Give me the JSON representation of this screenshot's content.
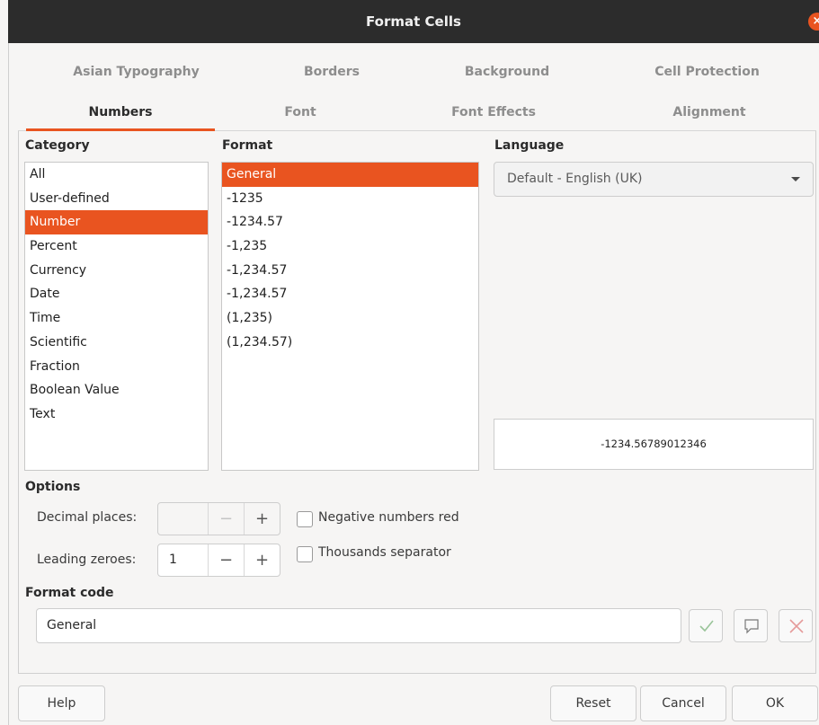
{
  "window": {
    "title": "Format Cells"
  },
  "tabs": {
    "row1": [
      "Asian Typography",
      "Borders",
      "Background",
      "Cell Protection"
    ],
    "row2": [
      "Numbers",
      "Font",
      "Font Effects",
      "Alignment"
    ],
    "active": "Numbers"
  },
  "category": {
    "label": "Category",
    "items": [
      "All",
      "User-defined",
      "Number",
      "Percent",
      "Currency",
      "Date",
      "Time",
      "Scientific",
      "Fraction",
      "Boolean Value",
      "Text"
    ],
    "selected": "Number"
  },
  "format": {
    "label": "Format",
    "items": [
      "General",
      "-1235",
      "-1234.57",
      "-1,235",
      "-1,234.57",
      "-1,234.57",
      "(1,235)",
      "(1,234.57)"
    ],
    "selected": "General"
  },
  "language": {
    "label": "Language",
    "value": "Default - English (UK)"
  },
  "preview": {
    "value": "-1234.56789012346"
  },
  "options": {
    "label": "Options",
    "decimal_places": {
      "label": "Decimal places:",
      "value": ""
    },
    "leading_zeroes": {
      "label": "Leading zeroes:",
      "value": "1"
    },
    "negative_red": {
      "label": "Negative numbers red",
      "checked": false
    },
    "thousands_sep": {
      "label": "Thousands separator",
      "checked": false
    }
  },
  "format_code": {
    "label": "Format code",
    "value": "General"
  },
  "buttons": {
    "help": "Help",
    "reset": "Reset",
    "cancel": "Cancel",
    "ok": "OK"
  },
  "colors": {
    "accent": "#e95420",
    "titlebar": "#2c2c2c"
  },
  "icons": {
    "close": "close-icon",
    "apply": "checkmark-icon",
    "comment": "comment-icon",
    "delete": "delete-x-icon",
    "dropdown": "chevron-down-icon"
  }
}
